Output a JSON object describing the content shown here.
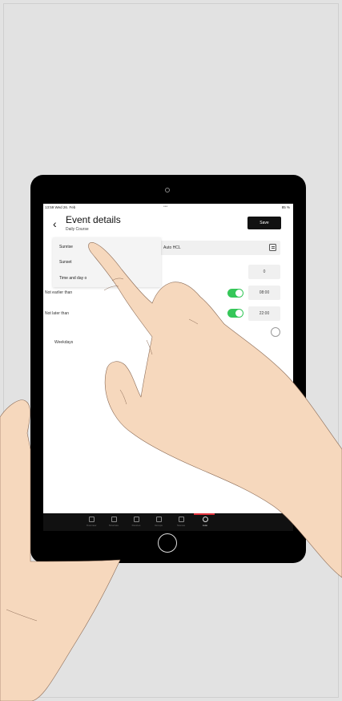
{
  "status_bar": {
    "time_date": "13:59 Wed 26. Feb",
    "dots": "•••",
    "battery": "85 %"
  },
  "header": {
    "back_icon": "chevron-left-icon",
    "title": "Event details",
    "subtitle": "Daily Course",
    "save_label": "Save"
  },
  "select_field": {
    "value": "Auto HCL",
    "icon": "calendar-edit-icon"
  },
  "dropdown": {
    "options": [
      "Sunrise",
      "Sunset",
      "Time and day o"
    ]
  },
  "offset": {
    "value": "0"
  },
  "rows": [
    {
      "label": "Not earlier than",
      "time": "08:00",
      "enabled": true
    },
    {
      "label": "Not later than",
      "time": "22:00",
      "enabled": true
    }
  ],
  "weekdays": {
    "label": "Weekdays"
  },
  "bottom_nav": {
    "items": [
      {
        "label": "Overview",
        "icon": "layout-icon"
      },
      {
        "label": "Structure",
        "icon": "layers-icon"
      },
      {
        "label": "Devices",
        "icon": "device-icon"
      },
      {
        "label": "Groups",
        "icon": "groups-icon"
      },
      {
        "label": "Scenes",
        "icon": "scenes-icon"
      },
      {
        "label": "Auto",
        "icon": "auto-icon"
      }
    ],
    "active_index": 5,
    "accent": "#e0303a"
  },
  "colors": {
    "toggle_on": "#35c759",
    "save_bg": "#111111",
    "skin": "#f6d8bd"
  }
}
